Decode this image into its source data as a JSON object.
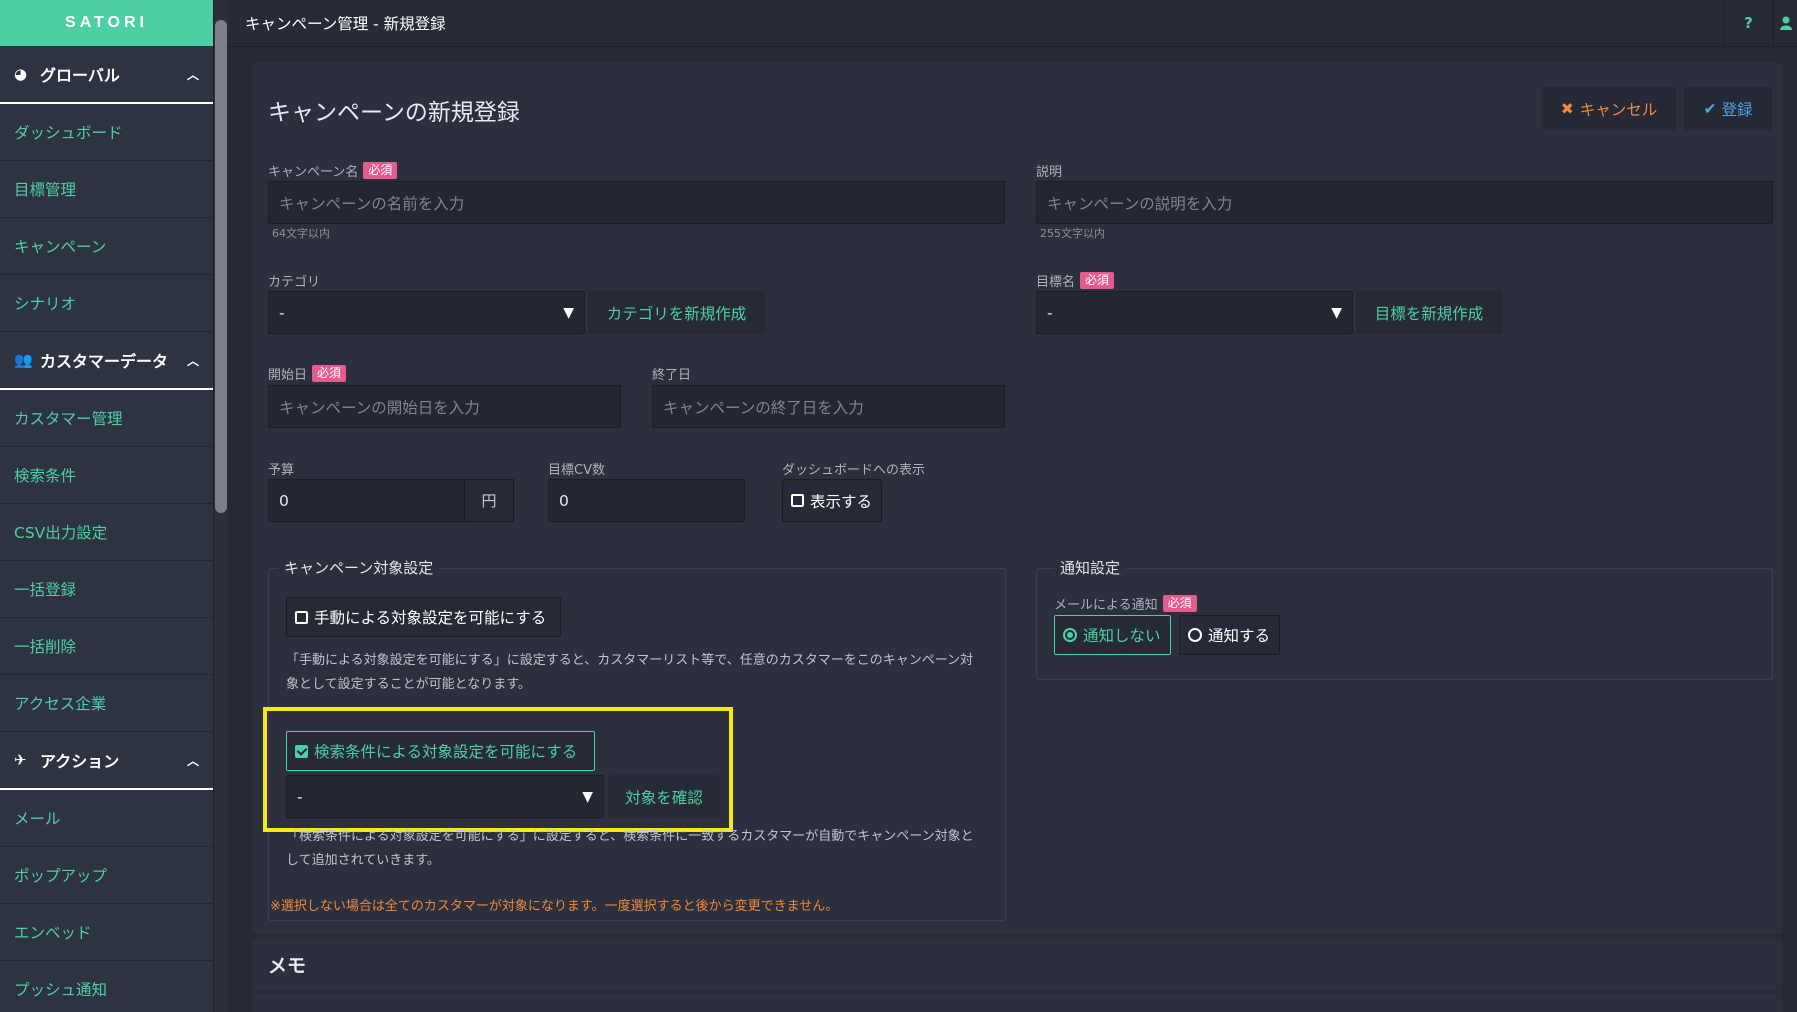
{
  "brand": "SATORI",
  "sidebar": {
    "groups": [
      {
        "label": "グローバル",
        "items": [
          "ダッシュボード",
          "目標管理",
          "キャンペーン",
          "シナリオ"
        ]
      },
      {
        "label": "カスタマーデータ",
        "items": [
          "カスタマー管理",
          "検索条件",
          "CSV出力設定",
          "一括登録",
          "一括削除",
          "アクセス企業"
        ]
      },
      {
        "label": "アクション",
        "items": [
          "メール",
          "ポップアップ",
          "エンベッド",
          "プッシュ通知"
        ]
      }
    ]
  },
  "topbar": {
    "title": "キャンペーン管理 - 新規登録",
    "help": "?"
  },
  "form": {
    "title": "キャンペーンの新規登録",
    "cancel_label": "キャンセル",
    "save_label": "登録",
    "required_badge": "必須",
    "name": {
      "label": "キャンペーン名",
      "placeholder": "キャンペーンの名前を入力",
      "hint": "64文字以内"
    },
    "description": {
      "label": "説明",
      "placeholder": "キャンペーンの説明を入力",
      "hint": "255文字以内"
    },
    "category": {
      "label": "カテゴリ",
      "value": "-",
      "create_label": "カテゴリを新規作成"
    },
    "goal": {
      "label": "目標名",
      "value": "-",
      "create_label": "目標を新規作成"
    },
    "start_date": {
      "label": "開始日",
      "placeholder": "キャンペーンの開始日を入力"
    },
    "end_date": {
      "label": "終了日",
      "placeholder": "キャンペーンの終了日を入力"
    },
    "budget": {
      "label": "予算",
      "value": "0",
      "unit": "円"
    },
    "target_cv": {
      "label": "目標CV数",
      "value": "0"
    },
    "dashboard": {
      "label": "ダッシュボードへの表示",
      "checkbox_label": "表示する",
      "checked": false
    }
  },
  "target": {
    "legend": "キャンペーン対象設定",
    "manual_label": "手動による対象設定を可能にする",
    "manual_checked": false,
    "manual_desc_1": "「手動による対象設定を可能にする」に設定すると、カスタマーリスト等で、任意のカスタマーをこのキャンペーン対",
    "manual_desc_2": "象として設定することが可能となります。",
    "search_label": "検索条件による対象設定を可能にする",
    "search_checked": true,
    "search_select_value": "-",
    "confirm_label": "対象を確認",
    "search_desc_1": "「検索条件による対象設定を可能にする」に設定すると、検索条件に一致するカスタマーが自動でキャンペーン対象と",
    "search_desc_2": "して追加されていきます。",
    "warning": "※選択しない場合は全てのカスタマーが対象になります。一度選択すると後から変更できません。"
  },
  "notify": {
    "legend": "通知設定",
    "email_label": "メールによる通知",
    "options": [
      "通知しない",
      "通知する"
    ],
    "selected": "通知しない"
  },
  "memo": {
    "title": "メモ"
  },
  "colors": {
    "accent": "#4ecfa2",
    "cancel": "#f0893a",
    "save": "#4fa3e0",
    "required": "#e45b8f",
    "highlight": "#f5ea14"
  }
}
